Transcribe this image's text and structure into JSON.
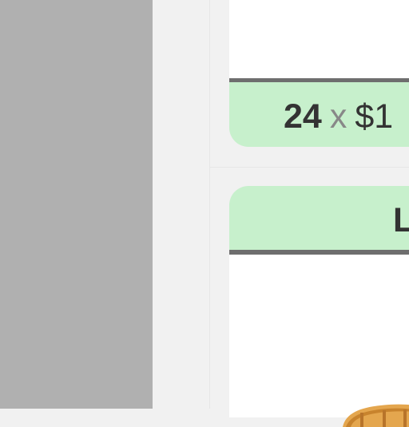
{
  "offer_top": {
    "quantity": "24",
    "times": "x",
    "price": "$1"
  },
  "offer_bottom": {
    "label": "L"
  },
  "icons": {
    "product": "furniture-product-image"
  },
  "colors": {
    "panel_gray": "#b0b0b0",
    "card_green": "#c7f0cc",
    "rule_gray": "#6e6e6e"
  }
}
